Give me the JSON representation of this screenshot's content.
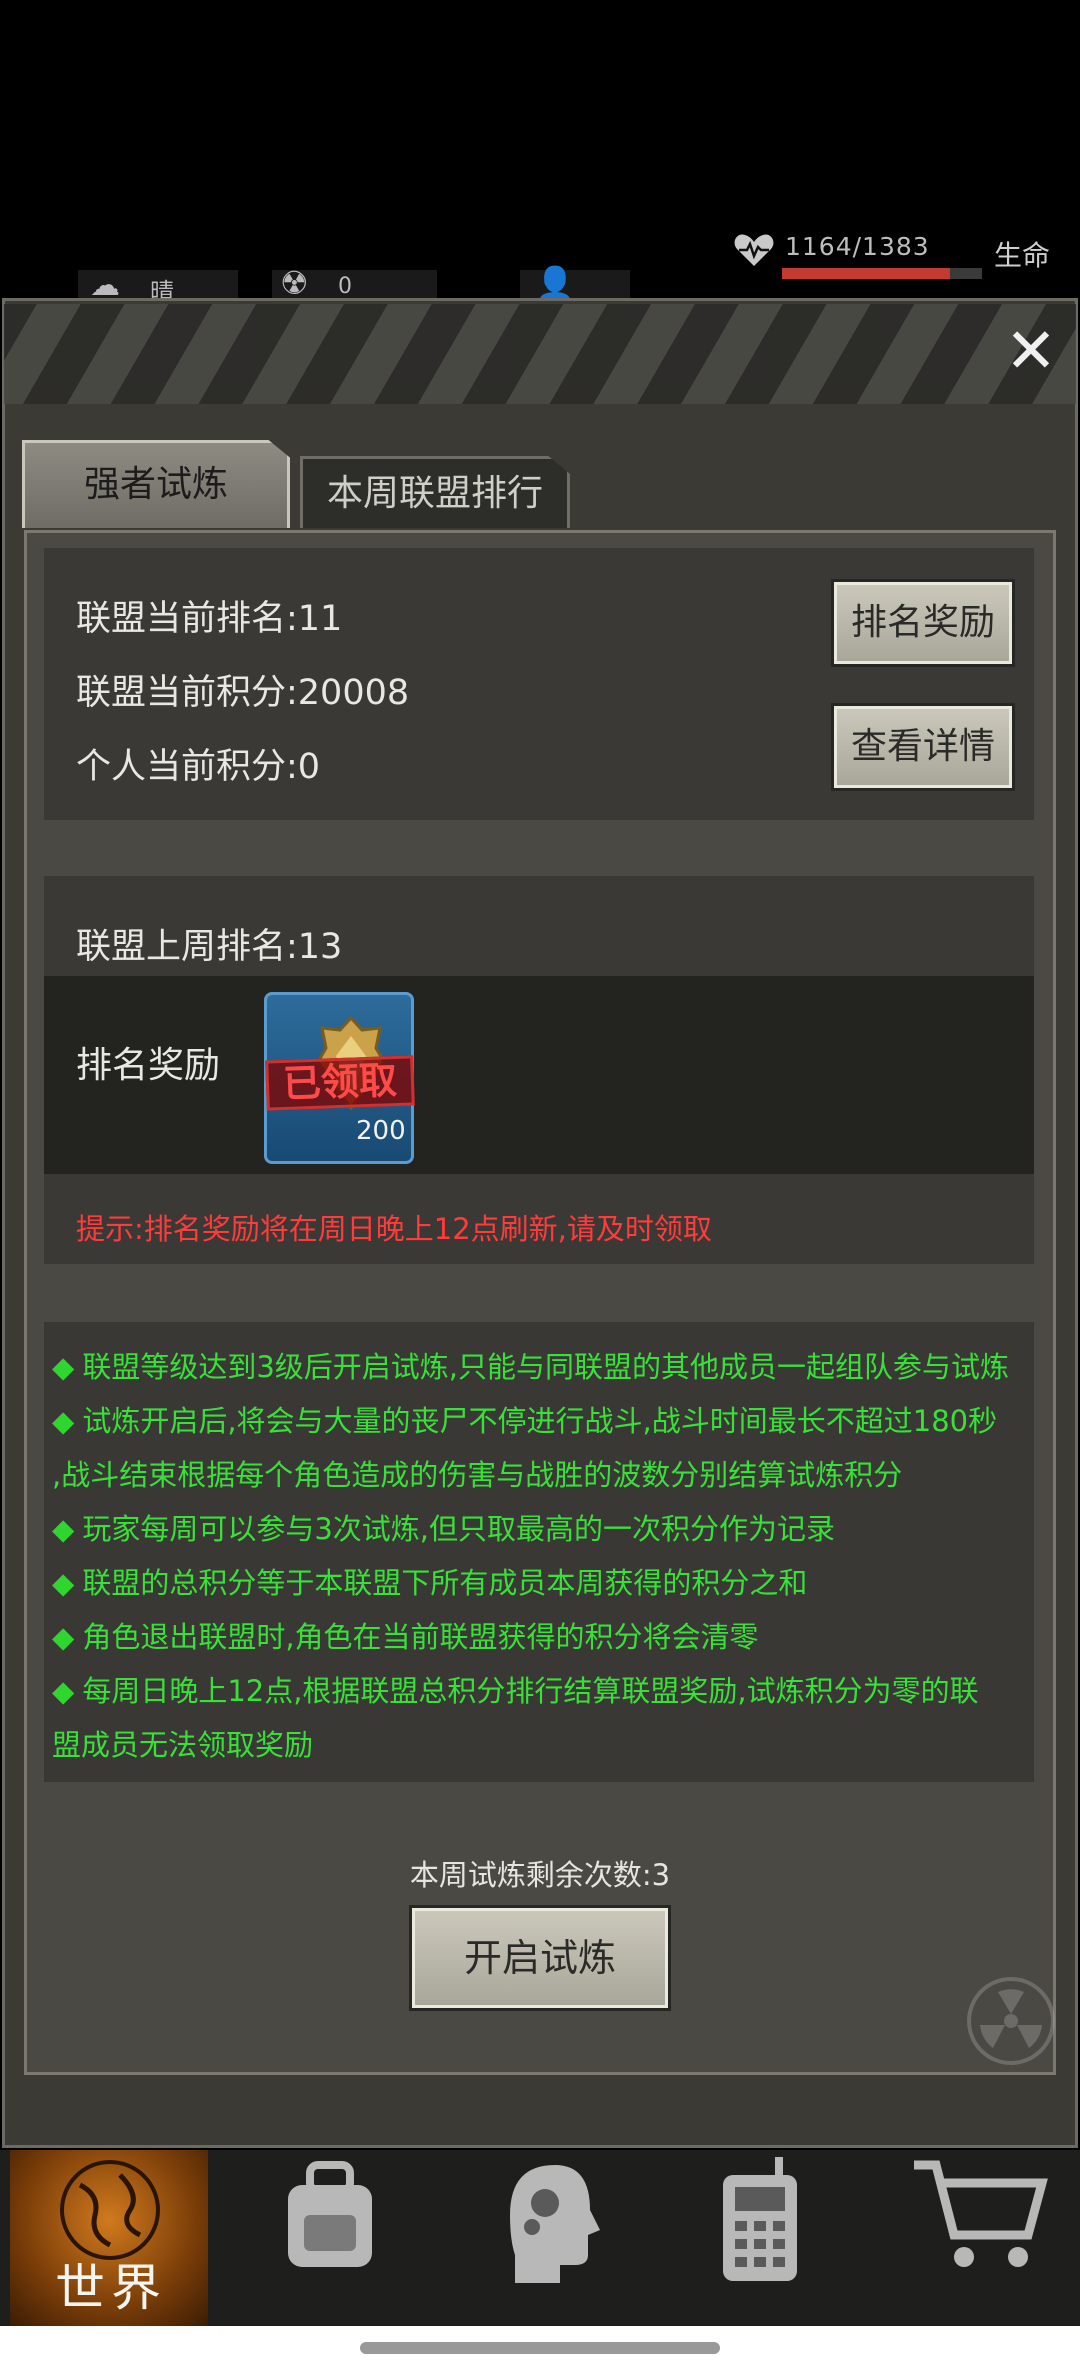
{
  "status": {
    "hp_text": "1164/1383",
    "hp_fraction": 0.84,
    "life_label": "生命",
    "weather_text": "晴",
    "radiation_value": "0"
  },
  "tabs": [
    {
      "label": "强者试炼",
      "active": true
    },
    {
      "label": "本周联盟排行",
      "active": false
    }
  ],
  "alliance": {
    "current_rank": "联盟当前排名:11",
    "current_score": "联盟当前积分:20008",
    "personal_score": "个人当前积分:0",
    "rank_reward_button": "排名奖励",
    "view_details_button": "查看详情"
  },
  "last_week": {
    "rank": "联盟上周排名:13",
    "reward_label": "排名奖励",
    "reward_stamp": "已领取",
    "reward_count": "200",
    "tip": "提示:排名奖励将在周日晚上12点刷新,请及时领取"
  },
  "rules": [
    "联盟等级达到3级后开启试炼,只能与同联盟的其他成员一起组队参与试炼",
    "试炼开启后,将会与大量的丧尸不停进行战斗,战斗时间最长不超过180秒",
    ",战斗结束根据每个角色造成的伤害与战胜的波数分别结算试炼积分",
    "玩家每周可以参与3次试炼,但只取最高的一次积分作为记录",
    "联盟的总积分等于本联盟下所有成员本周获得的积分之和",
    "角色退出联盟时,角色在当前联盟获得的积分将会清零",
    "每周日晚上12点,根据联盟总积分排行结算联盟奖励,试炼积分为零的联",
    "盟成员无法领取奖励"
  ],
  "remaining": "本周试炼剩余次数:3",
  "start_button": "开启试炼",
  "nav": {
    "world_label": "世界",
    "items": [
      "globe-icon",
      "backpack-icon",
      "head-gears-icon",
      "radio-icon",
      "cart-icon"
    ]
  },
  "colors": {
    "rule_text": "#39e039",
    "tip_text": "#ff3b3b",
    "panel_bg": "#3b3a35",
    "hp_bar": "#c23a30"
  }
}
